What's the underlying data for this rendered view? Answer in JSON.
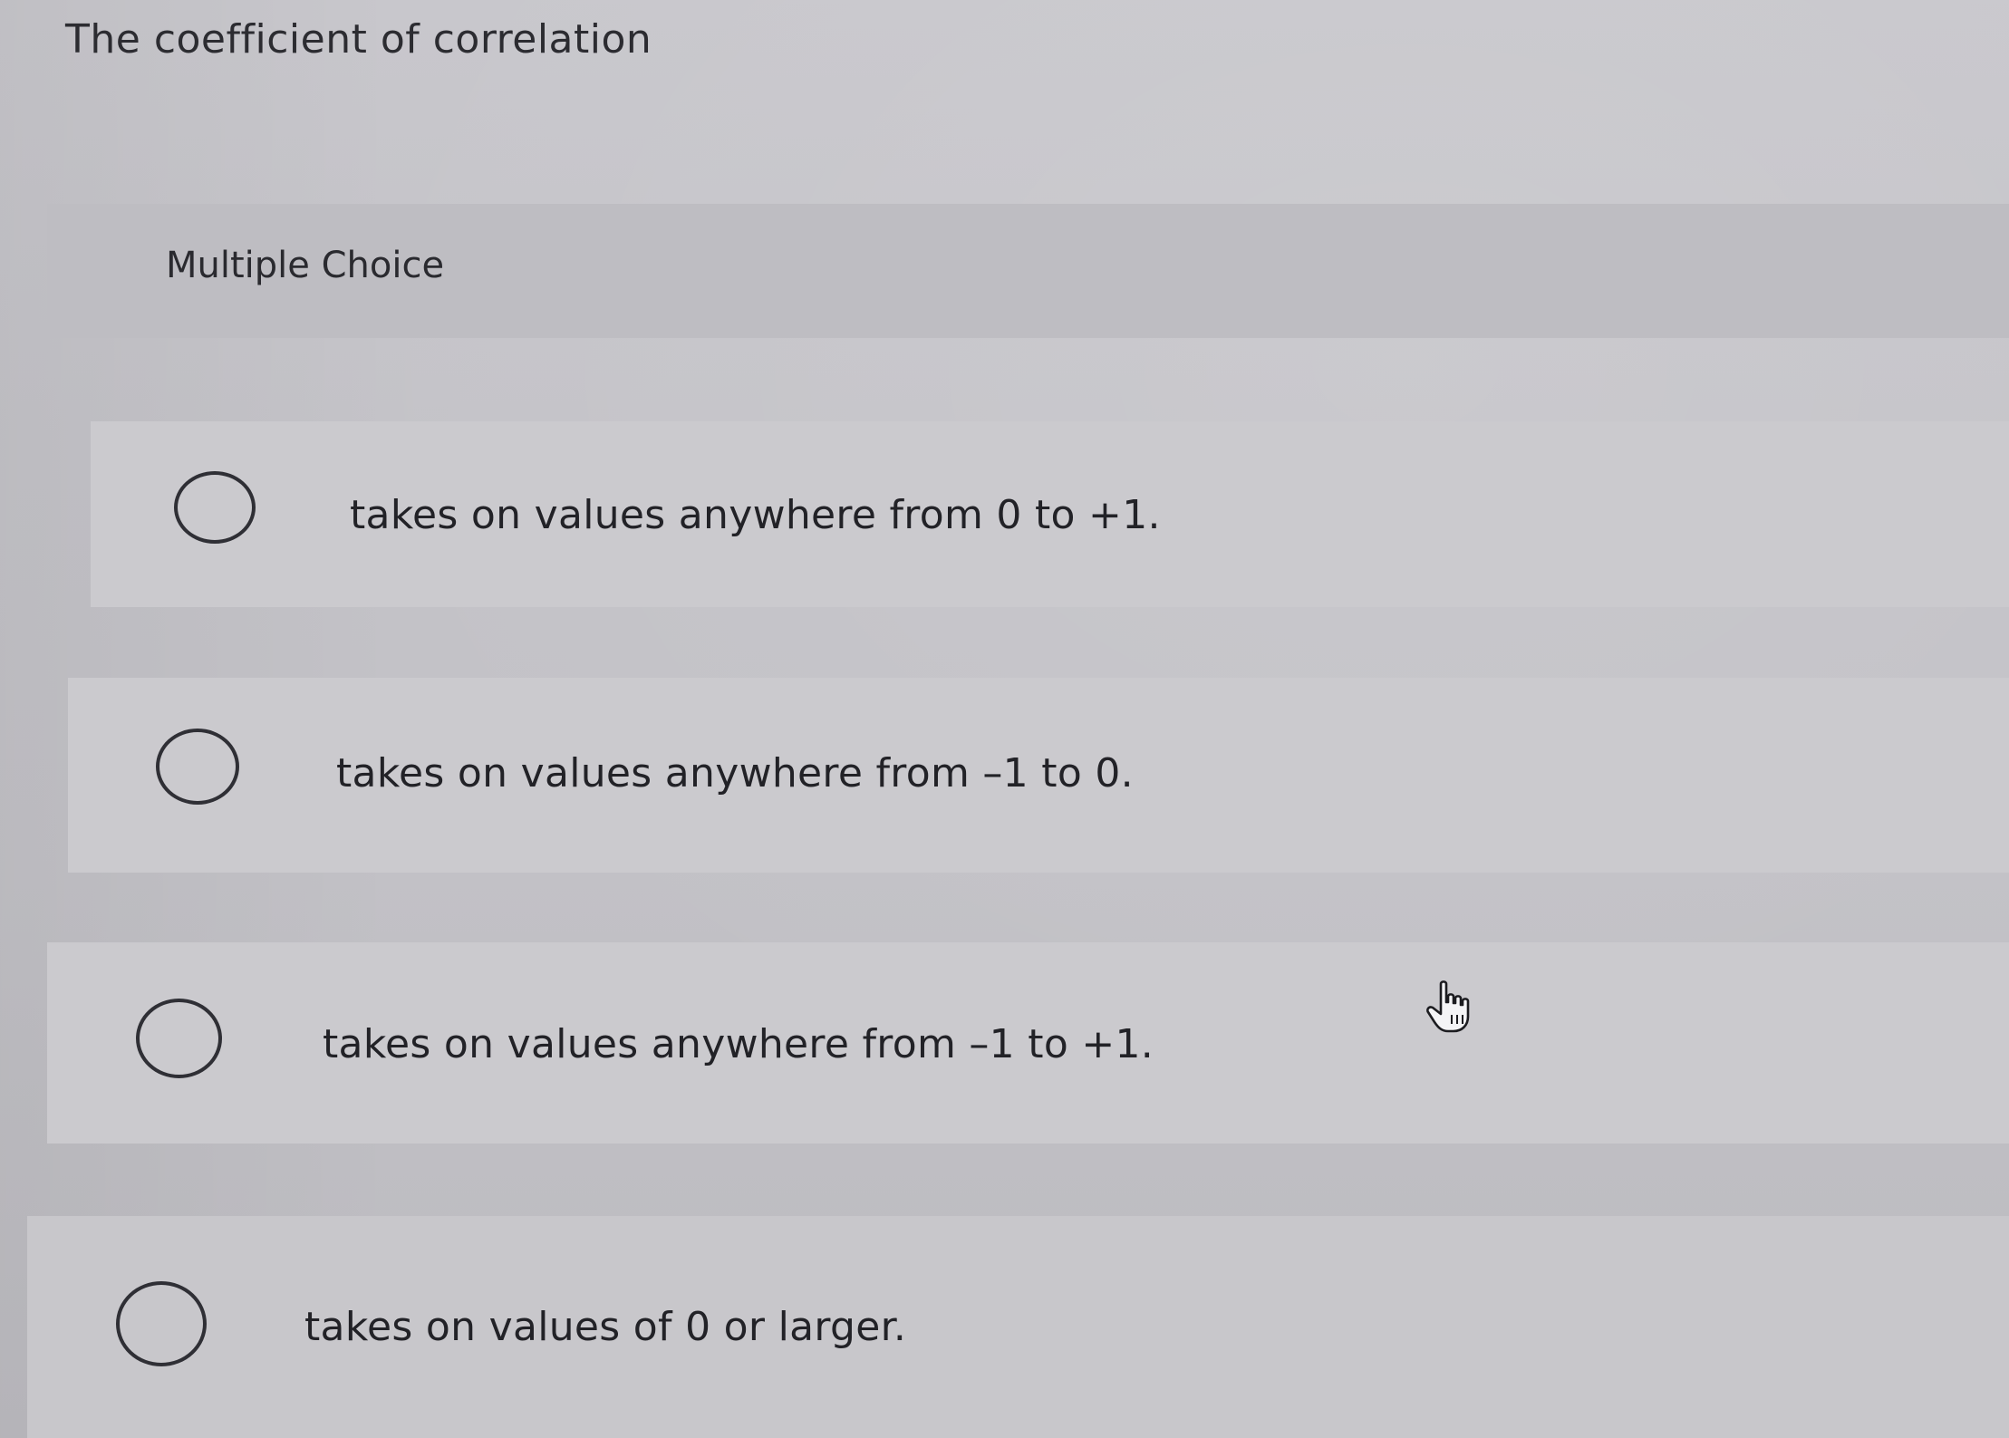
{
  "question": {
    "text": "The coefficient of correlation"
  },
  "section": {
    "label": "Multiple Choice"
  },
  "options": [
    {
      "text": "takes on values anywhere from 0 to +1.",
      "selected": false
    },
    {
      "text": "takes on values anywhere from –1 to 0.",
      "selected": false
    },
    {
      "text": "takes on values anywhere from –1 to +1.",
      "selected": false
    },
    {
      "text": "takes on values of 0 or larger.",
      "selected": false
    }
  ],
  "cursor": {
    "icon": "hand-pointer-icon"
  },
  "colors": {
    "background": "#c4c3c8",
    "text": "#26262b",
    "radio_border": "#2f2f35"
  }
}
